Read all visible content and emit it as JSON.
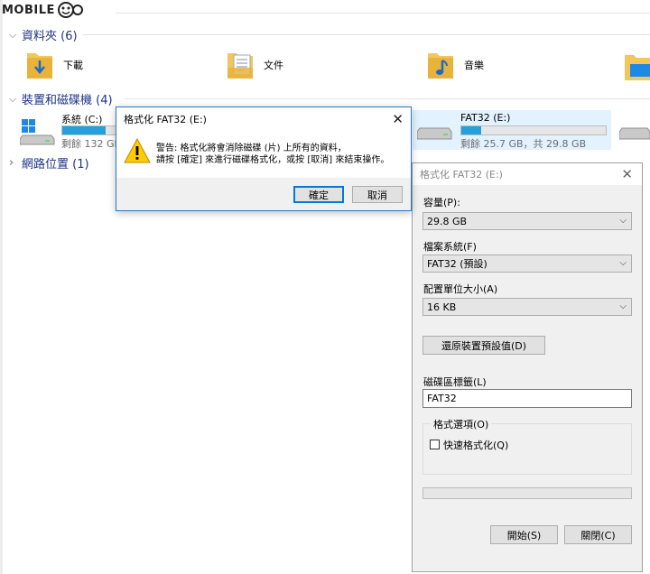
{
  "watermark": {
    "text": "MOBILE"
  },
  "explorer": {
    "folders_group": {
      "label": "資料夾 (6)"
    },
    "folders": [
      {
        "label": "下載",
        "icon": "download-folder-icon"
      },
      {
        "label": "文件",
        "icon": "documents-folder-icon"
      },
      {
        "label": "音樂",
        "icon": "music-folder-icon"
      }
    ],
    "devices_group": {
      "label": "裝置和磁碟機 (4)"
    },
    "drives": [
      {
        "name": "系統 (C:)",
        "free_text": "剩餘 132 GB",
        "used_fraction": 0.8
      },
      {
        "name": "FAT32 (E:)",
        "free_text": "剩餘 25.7 GB，共 29.8 GB",
        "used_fraction": 0.14
      }
    ],
    "network_group": {
      "label": "網路位置 (1)"
    }
  },
  "confirm_dialog": {
    "title": "格式化 FAT32 (E:)",
    "message_line1": "警告: 格式化將會消除磁碟 (片) 上所有的資料，",
    "message_line2": "請按 [確定] 來進行磁碟格式化，或按 [取消] 來結束操作。",
    "ok_label": "確定",
    "cancel_label": "取消"
  },
  "format_window": {
    "title": "格式化 FAT32 (E:)",
    "capacity_label": "容量(P):",
    "capacity_value": "29.8 GB",
    "filesystem_label": "檔案系統(F)",
    "filesystem_value": "FAT32 (預設)",
    "alloc_label": "配置單位大小(A)",
    "alloc_value": "16 KB",
    "restore_label": "還原裝置預設值(D)",
    "volume_label_label": "磁碟區標籤(L)",
    "volume_label_value": "FAT32",
    "options_label": "格式選項(O)",
    "quick_format_label": "快速格式化(Q)",
    "quick_format_checked": false,
    "progress": 0,
    "start_label": "開始(S)",
    "close_label": "關閉(C)"
  }
}
